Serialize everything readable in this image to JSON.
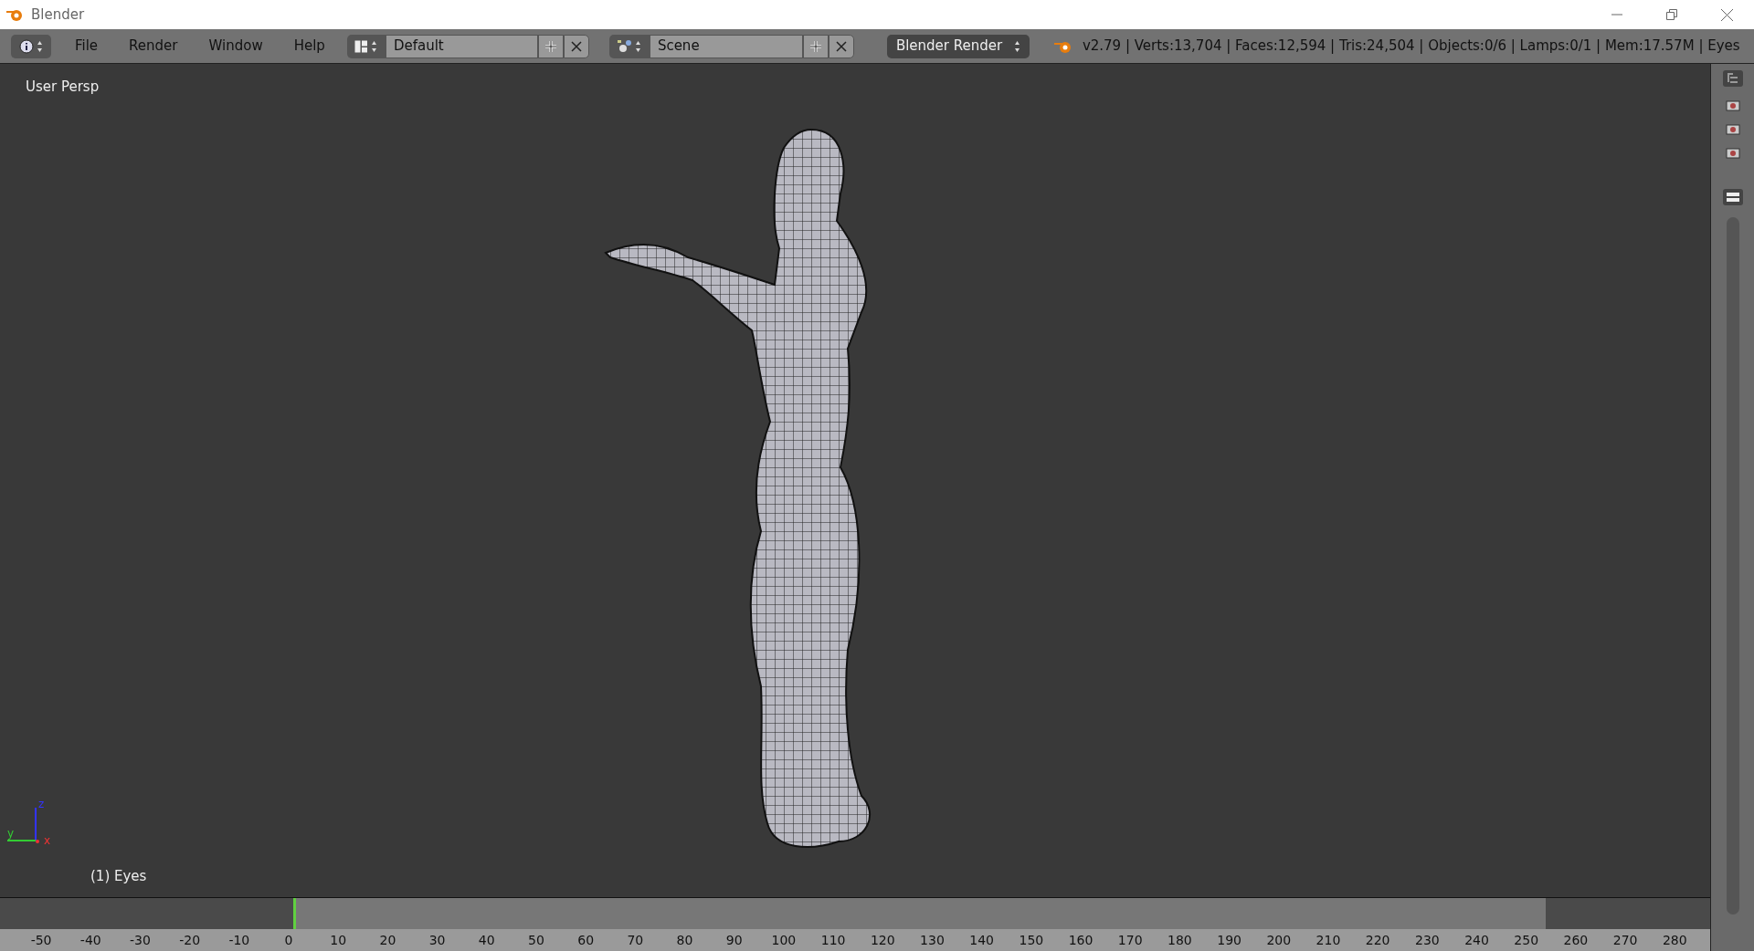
{
  "window": {
    "title": "Blender"
  },
  "menu": [
    "File",
    "Render",
    "Window",
    "Help"
  ],
  "layout_selector": {
    "value": "Default"
  },
  "scene_selector": {
    "value": "Scene"
  },
  "render_engine": {
    "value": "Blender Render"
  },
  "stats": "v2.79 | Verts:13,704 | Faces:12,594 | Tris:24,504 | Objects:0/6 | Lamps:0/1 | Mem:17.57M | Eyes",
  "viewport": {
    "view_label": "User Persp",
    "object_label": "(1) Eyes",
    "axes": [
      "z",
      "y",
      "x"
    ]
  },
  "timeline": {
    "ticks": [
      "-50",
      "-40",
      "-30",
      "-20",
      "-10",
      "0",
      "10",
      "20",
      "30",
      "40",
      "50",
      "60",
      "70",
      "80",
      "90",
      "100",
      "110",
      "120",
      "130",
      "140",
      "150",
      "160",
      "170",
      "180",
      "190",
      "200",
      "210",
      "220",
      "230",
      "240",
      "250",
      "260",
      "270",
      "280"
    ]
  }
}
